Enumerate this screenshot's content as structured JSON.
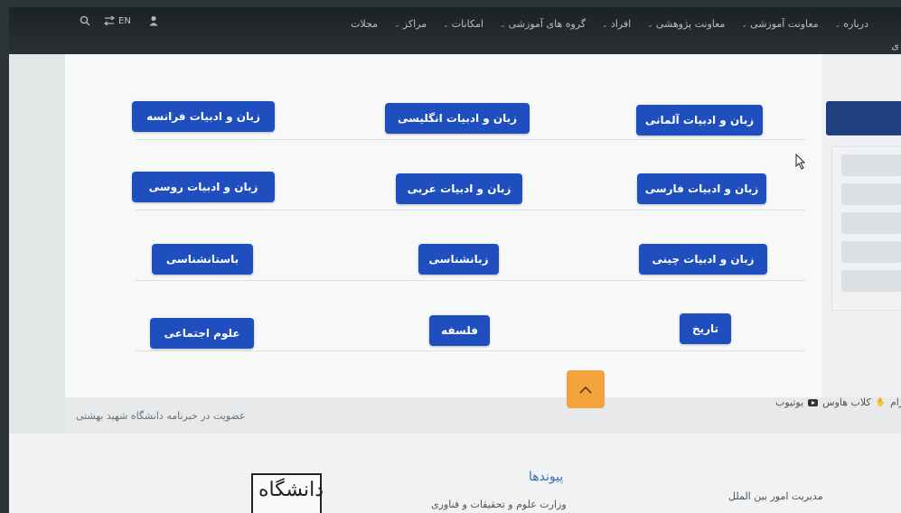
{
  "nav": {
    "items": [
      "درباره",
      "معاونت آموزشی",
      "معاونت پژوهشی",
      "افراد",
      "گروه های آموزشی",
      "امکانات",
      "مراکز",
      "مجلات"
    ],
    "cut_label": "ی",
    "lang": "EN"
  },
  "departments": [
    [
      "زبان و ادبیات آلمانی",
      "زبان و ادبیات انگلیسی",
      "زبان و ادبیات فرانسه"
    ],
    [
      "زبان و ادبیات فارسی",
      "زبان و ادبیات عربی",
      "زبان و ادبیات روسی"
    ],
    [
      "زبان و ادبیات چینی",
      "زبانشناسی",
      "باستانشناسی"
    ],
    [
      "تاریخ",
      "فلسفه",
      "علوم اجتماعی"
    ]
  ],
  "footer": {
    "membership": "عضویت در خبرنامه دانشگاه شهید بهشتی",
    "social_youtube": "یوتیوب",
    "social_clubhouse": "کلاب هاوس",
    "social_telegram": "رام",
    "links_title": "پیوندها",
    "link_1": "وزارت علوم و تحقیقات و فناوری",
    "intl": "مدیریت امور بین الملل",
    "logo_text": "دانشگاه"
  },
  "colors": {
    "button": "#1f4fbf",
    "topbar": "#1c2226",
    "scroll_top": "#f2a33a"
  },
  "icons": [
    "search-icon",
    "language-icon",
    "user-icon",
    "chevron-up-icon",
    "youtube-icon",
    "clubhouse-icon",
    "cursor-icon"
  ]
}
